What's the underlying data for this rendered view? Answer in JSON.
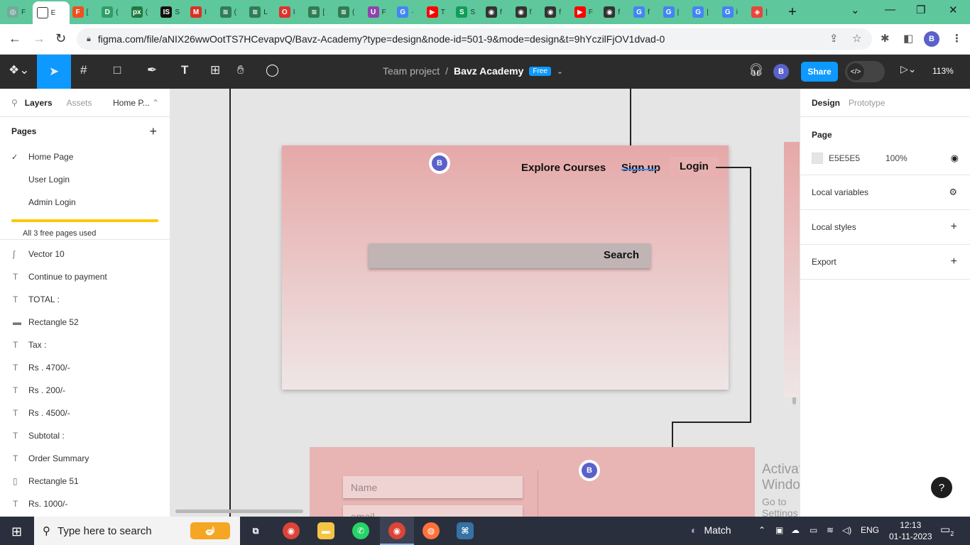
{
  "browser": {
    "tabs": [
      {
        "icon": "openai-icon",
        "title": "F",
        "color": "#74aa9c",
        "glyph": "◎"
      },
      {
        "icon": "figma-tab-icon",
        "title": "E",
        "color": "#ffffff",
        "glyph": "",
        "active": true
      },
      {
        "icon": "figma-icon",
        "title": "[",
        "color": "#f24e1e",
        "glyph": "F"
      },
      {
        "icon": "d-icon",
        "title": "(",
        "color": "#2f9e6a",
        "glyph": "D"
      },
      {
        "icon": "px-icon",
        "title": "(",
        "color": "#1f7a3f",
        "glyph": "px"
      },
      {
        "icon": "is-icon",
        "title": "S",
        "color": "#111111",
        "glyph": "IS"
      },
      {
        "icon": "gmail-icon",
        "title": "I",
        "color": "#d93025",
        "glyph": "M"
      },
      {
        "icon": "layers-icon",
        "title": "(",
        "color": "#2f7d55",
        "glyph": "≋"
      },
      {
        "icon": "layers-icon",
        "title": "L",
        "color": "#2f7d55",
        "glyph": "≋"
      },
      {
        "icon": "opera-icon",
        "title": "I",
        "color": "#e0312b",
        "glyph": "O"
      },
      {
        "icon": "layers-icon",
        "title": "[",
        "color": "#2f7d55",
        "glyph": "≋"
      },
      {
        "icon": "layers-icon",
        "title": "(",
        "color": "#2f7d55",
        "glyph": "≋"
      },
      {
        "icon": "u-icon",
        "title": "F",
        "color": "#8e44ad",
        "glyph": "U"
      },
      {
        "icon": "google-icon",
        "title": "·",
        "color": "#4285f4",
        "glyph": "G"
      },
      {
        "icon": "youtube-icon",
        "title": "T",
        "color": "#ff0000",
        "glyph": "▶"
      },
      {
        "icon": "s-icon",
        "title": "S",
        "color": "#0f9d58",
        "glyph": "S"
      },
      {
        "icon": "github-icon",
        "title": "f",
        "color": "#333333",
        "glyph": "◉"
      },
      {
        "icon": "github-icon",
        "title": "f",
        "color": "#333333",
        "glyph": "◉"
      },
      {
        "icon": "github-icon",
        "title": "f",
        "color": "#333333",
        "glyph": "◉"
      },
      {
        "icon": "youtube-icon",
        "title": "F",
        "color": "#ff0000",
        "glyph": "▶"
      },
      {
        "icon": "github-icon",
        "title": "f",
        "color": "#333333",
        "glyph": "◉"
      },
      {
        "icon": "google-icon",
        "title": "f",
        "color": "#4285f4",
        "glyph": "G"
      },
      {
        "icon": "google-icon",
        "title": "|",
        "color": "#4285f4",
        "glyph": "G"
      },
      {
        "icon": "google-icon",
        "title": "|",
        "color": "#4285f4",
        "glyph": "G"
      },
      {
        "icon": "google-icon",
        "title": "i",
        "color": "#4285f4",
        "glyph": "G"
      },
      {
        "icon": "lens-icon",
        "title": "|",
        "color": "#e8453c",
        "glyph": "◈"
      }
    ],
    "url": "figma.com/file/aNIX26wwOotTS7HCevapvQ/Bavz-Academy?type=design&node-id=501-9&mode=design&t=9hYczilFjOV1dvad-0",
    "profile_initial": "B"
  },
  "toolbar": {
    "team": "Team project",
    "separator": "/",
    "project": "Bavz Academy",
    "badge": "Free",
    "user_initial": "B",
    "share_label": "Share",
    "zoom": "113%"
  },
  "left_panel": {
    "tab_layers": "Layers",
    "tab_assets": "Assets",
    "page_selector": "Home P...",
    "pages_header": "Pages",
    "pages": [
      {
        "label": "Home Page",
        "active": true
      },
      {
        "label": "User Login",
        "active": false
      },
      {
        "label": "Admin Login",
        "active": false
      }
    ],
    "usage_text": "All 3 free pages used",
    "layers": [
      {
        "label": "Vector 10",
        "icon": "vector-icon",
        "glyph": "∫"
      },
      {
        "label": "Continue to payment",
        "icon": "text-icon",
        "glyph": "T"
      },
      {
        "label": "TOTAL :",
        "icon": "text-icon",
        "glyph": "T"
      },
      {
        "label": "Rectangle 52",
        "icon": "line-icon",
        "glyph": "▬"
      },
      {
        "label": "Tax :",
        "icon": "text-icon",
        "glyph": "T"
      },
      {
        "label": "Rs . 4700/-",
        "icon": "text-icon",
        "glyph": "T"
      },
      {
        "label": "Rs . 200/-",
        "icon": "text-icon",
        "glyph": "T"
      },
      {
        "label": "Rs . 4500/-",
        "icon": "text-icon",
        "glyph": "T"
      },
      {
        "label": "Subtotal :",
        "icon": "text-icon",
        "glyph": "T"
      },
      {
        "label": "Order Summary",
        "icon": "text-icon",
        "glyph": "T"
      },
      {
        "label": "Rectangle 51",
        "icon": "rectangle-icon",
        "glyph": "▯"
      },
      {
        "label": "Rs. 1000/-",
        "icon": "text-icon",
        "glyph": "T"
      }
    ]
  },
  "canvas": {
    "nav_explore": "Explore Courses",
    "nav_signup": "Sign up",
    "nav_login": "Login",
    "search_label": "Search",
    "logo_initial": "B",
    "field_name": "Name",
    "field_email": "email",
    "activate_title": "Activate Windows",
    "activate_sub": "Go to Settings to activate Windows."
  },
  "right_panel": {
    "tab_design": "Design",
    "tab_prototype": "Prototype",
    "page_header": "Page",
    "page_color": "E5E5E5",
    "page_opacity": "100%",
    "local_variables": "Local variables",
    "local_styles": "Local styles",
    "export": "Export"
  },
  "taskbar": {
    "search_placeholder": "Type here to search",
    "match_label": "Match",
    "language": "ENG",
    "time": "12:13",
    "date": "01-11-2023",
    "notif_count": "2"
  },
  "colors": {
    "figma_blue": "#0d99ff",
    "tab_strip": "#5ec79b",
    "frame_pink": "#e6a8a8"
  }
}
